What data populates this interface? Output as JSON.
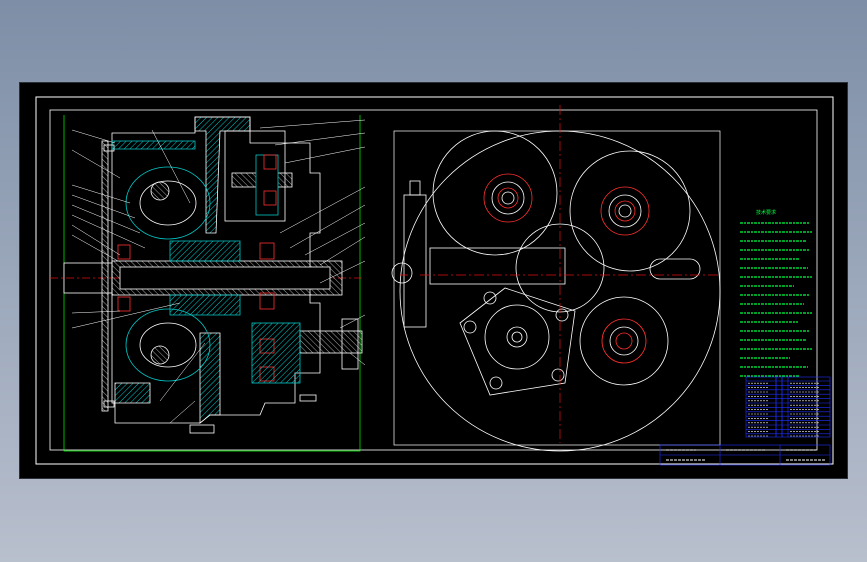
{
  "drawing": {
    "background": "#000000",
    "frame_color": "#ffffff",
    "geometry_color": "#ffffff",
    "hatch_color": "#00c8c8",
    "centerline_color": "#e01010",
    "dimension_color": "#00ff00",
    "note_text_color": "#00ff40",
    "bearing_color": "#ff3030"
  },
  "technical_notes": {
    "title": "技术要求"
  },
  "title_block": {
    "table_color": "#2030ff",
    "text_color": "#ffffff"
  }
}
